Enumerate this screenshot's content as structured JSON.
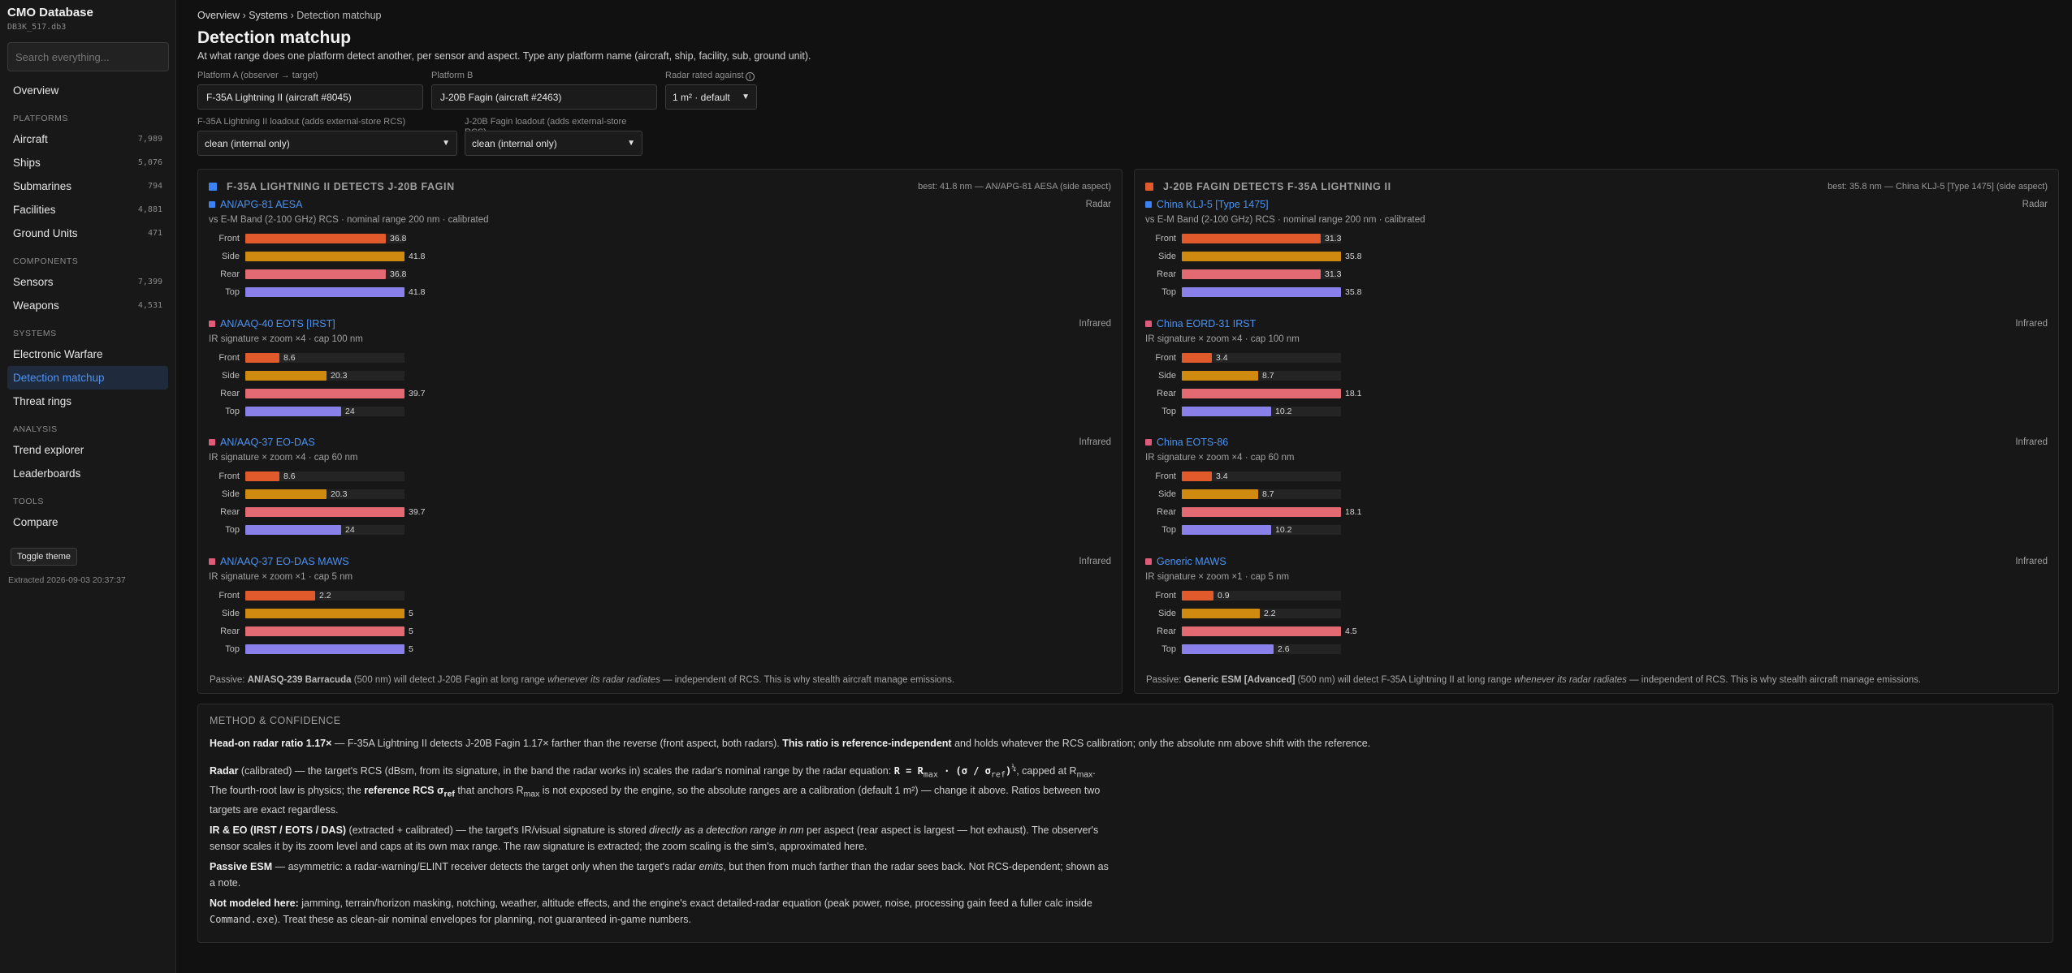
{
  "sidebar": {
    "title": "CMO Database",
    "db_file": "DB3K_517.db3",
    "search_placeholder": "Search everything...",
    "overview": "Overview",
    "sections": [
      {
        "label": "PLATFORMS",
        "items": [
          {
            "label": "Aircraft",
            "count": "7,989"
          },
          {
            "label": "Ships",
            "count": "5,076"
          },
          {
            "label": "Submarines",
            "count": "794"
          },
          {
            "label": "Facilities",
            "count": "4,881"
          },
          {
            "label": "Ground Units",
            "count": "471"
          }
        ]
      },
      {
        "label": "COMPONENTS",
        "items": [
          {
            "label": "Sensors",
            "count": "7,399"
          },
          {
            "label": "Weapons",
            "count": "4,531"
          }
        ]
      },
      {
        "label": "SYSTEMS",
        "items": [
          {
            "label": "Electronic Warfare",
            "count": ""
          },
          {
            "label": "Detection matchup",
            "count": "",
            "active": true
          },
          {
            "label": "Threat rings",
            "count": ""
          }
        ]
      },
      {
        "label": "ANALYSIS",
        "items": [
          {
            "label": "Trend explorer",
            "count": ""
          },
          {
            "label": "Leaderboards",
            "count": ""
          }
        ]
      },
      {
        "label": "TOOLS",
        "items": [
          {
            "label": "Compare",
            "count": ""
          }
        ]
      }
    ],
    "toggle_theme": "Toggle theme",
    "extracted": "Extracted 2026-09-03 20:37:37"
  },
  "page": {
    "breadcrumb": [
      "Overview",
      "Systems",
      "Detection matchup"
    ],
    "title": "Detection matchup",
    "subtitle": "At what range does one platform detect another, per sensor and aspect. Type any platform name (aircraft, ship, facility, sub, ground unit).",
    "platform_a_label": "Platform A (observer → target)",
    "platform_a_value": "F-35A Lightning II (aircraft #8045)",
    "platform_b_label": "Platform B",
    "platform_b_value": "J-20B Fagin (aircraft #2463)",
    "radar_label": "Radar rated against",
    "radar_value": "1 m² · default",
    "loadout_a_label": "F-35A Lightning II loadout (adds external-store RCS)",
    "loadout_a_value": "clean (internal only)",
    "loadout_b_label": "J-20B Fagin loadout (adds external-store RCS)",
    "loadout_b_value": "clean (internal only)"
  },
  "colors": {
    "front": "#e05a2b",
    "side": "#d08a10",
    "rear": "#e36a72",
    "top": "#8a80ea",
    "radar_marker": "#3b82f6",
    "ir_marker": "#e05a7a",
    "panel_a": "#3b82f6",
    "panel_b": "#e05a2b"
  },
  "panels": [
    {
      "title": "F-35A LIGHTNING II DETECTS J-20B FAGIN",
      "best": "best: 41.8 nm — AN/APG-81 AESA (side aspect)",
      "sensors": [
        {
          "name": "AN/APG-81 AESA",
          "type": "Radar",
          "desc": "vs E-M Band (2-100 GHz) RCS · nominal range 200 nm · calibrated",
          "scale_max": 41.8,
          "bars": [
            {
              "label": "Front",
              "value": 36.8
            },
            {
              "label": "Side",
              "value": 41.8
            },
            {
              "label": "Rear",
              "value": 36.8
            },
            {
              "label": "Top",
              "value": 41.8
            }
          ]
        },
        {
          "name": "AN/AAQ-40 EOTS [IRST]",
          "type": "Infrared",
          "desc": "IR signature × zoom ×4 · cap 100 nm",
          "scale_max": 39.7,
          "bars": [
            {
              "label": "Front",
              "value": 8.6
            },
            {
              "label": "Side",
              "value": 20.3
            },
            {
              "label": "Rear",
              "value": 39.7
            },
            {
              "label": "Top",
              "value": 24
            }
          ]
        },
        {
          "name": "AN/AAQ-37 EO-DAS",
          "type": "Infrared",
          "desc": "IR signature × zoom ×4 · cap 60 nm",
          "scale_max": 39.7,
          "bars": [
            {
              "label": "Front",
              "value": 8.6
            },
            {
              "label": "Side",
              "value": 20.3
            },
            {
              "label": "Rear",
              "value": 39.7
            },
            {
              "label": "Top",
              "value": 24
            }
          ]
        },
        {
          "name": "AN/AAQ-37 EO-DAS MAWS",
          "type": "Infrared",
          "desc": "IR signature × zoom ×1 · cap 5 nm",
          "scale_max": 5,
          "bars": [
            {
              "label": "Front",
              "value": 2.2
            },
            {
              "label": "Side",
              "value": 5
            },
            {
              "label": "Rear",
              "value": 5
            },
            {
              "label": "Top",
              "value": 5
            }
          ]
        }
      ],
      "passive_pre": "Passive: ",
      "passive_sensor": "AN/ASQ-239 Barracuda",
      "passive_mid": " (500 nm) will detect J-20B Fagin at long range ",
      "passive_em": "whenever its radar radiates",
      "passive_post": " — independent of RCS. This is why stealth aircraft manage emissions."
    },
    {
      "title": "J-20B FAGIN DETECTS F-35A LIGHTNING II",
      "best": "best: 35.8 nm — China KLJ-5 [Type 1475] (side aspect)",
      "sensors": [
        {
          "name": "China KLJ-5 [Type 1475]",
          "type": "Radar",
          "desc": "vs E-M Band (2-100 GHz) RCS · nominal range 200 nm · calibrated",
          "scale_max": 35.8,
          "bars": [
            {
              "label": "Front",
              "value": 31.3
            },
            {
              "label": "Side",
              "value": 35.8
            },
            {
              "label": "Rear",
              "value": 31.3
            },
            {
              "label": "Top",
              "value": 35.8
            }
          ]
        },
        {
          "name": "China EORD-31 IRST",
          "type": "Infrared",
          "desc": "IR signature × zoom ×4 · cap 100 nm",
          "scale_max": 18.1,
          "bars": [
            {
              "label": "Front",
              "value": 3.4
            },
            {
              "label": "Side",
              "value": 8.7
            },
            {
              "label": "Rear",
              "value": 18.1
            },
            {
              "label": "Top",
              "value": 10.2
            }
          ]
        },
        {
          "name": "China EOTS-86",
          "type": "Infrared",
          "desc": "IR signature × zoom ×4 · cap 60 nm",
          "scale_max": 18.1,
          "bars": [
            {
              "label": "Front",
              "value": 3.4
            },
            {
              "label": "Side",
              "value": 8.7
            },
            {
              "label": "Rear",
              "value": 18.1
            },
            {
              "label": "Top",
              "value": 10.2
            }
          ]
        },
        {
          "name": "Generic MAWS",
          "type": "Infrared",
          "desc": "IR signature × zoom ×1 · cap 5 nm",
          "scale_max": 4.5,
          "bars": [
            {
              "label": "Front",
              "value": 0.9
            },
            {
              "label": "Side",
              "value": 2.2
            },
            {
              "label": "Rear",
              "value": 4.5
            },
            {
              "label": "Top",
              "value": 2.6
            }
          ]
        }
      ],
      "passive_pre": "Passive: ",
      "passive_sensor": "Generic ESM [Advanced]",
      "passive_mid": " (500 nm) will detect F-35A Lightning II at long range ",
      "passive_em": "whenever its radar radiates",
      "passive_post": " — independent of RCS. This is why stealth aircraft manage emissions."
    }
  ],
  "method": {
    "title": "METHOD & CONFIDENCE",
    "p1_bold": "Head-on radar ratio 1.17×",
    "p1_mid": " — F-35A Lightning II detects J-20B Fagin 1.17× farther than the reverse (front aspect, both radars). ",
    "p1_bold2": "This ratio is reference-independent",
    "p1_post": " and holds whatever the RCS calibration; only the absolute nm above shift with the reference.",
    "p2_bold": "Radar",
    "p2_a": " (calibrated) — the target's RCS (dBsm, from its signature, in the band the radar works in) scales the radar's nominal range by the radar equation: ",
    "p2_formula": "R = R",
    "p2_formula_sub": "max",
    "p2_formula2": " · (σ / σ",
    "p2_formula2_sub": "ref",
    "p2_formula3": ")",
    "p2_formula3_sup": "¼",
    "p2_b": ", capped at R",
    "p2_b_sub": "max",
    "p2_c": ". The fourth-root law is physics; the ",
    "p2_bold2": "reference RCS σ",
    "p2_bold2_sub": "ref",
    "p2_d": " that anchors R",
    "p2_d_sub": "max",
    "p2_e": " is not exposed by the engine, so the absolute ranges are a calibration (default 1 m²) — change it above. Ratios between two targets are exact regardless.",
    "p3_bold": "IR & EO (IRST / EOTS / DAS)",
    "p3_a": " (extracted + calibrated) — the target's IR/visual signature is stored ",
    "p3_em": "directly as a detection range in nm",
    "p3_b": " per aspect (rear aspect is largest — hot exhaust). The observer's sensor scales it by its zoom level and caps at its own max range. The raw signature is extracted; the zoom scaling is the sim's, approximated here.",
    "p4_bold": "Passive ESM",
    "p4_a": " — asymmetric: a radar-warning/ELINT receiver detects the target only when the target's radar ",
    "p4_em": "emits",
    "p4_b": ", but then from much farther than the radar sees back. Not RCS-dependent; shown as a note.",
    "p5_bold": "Not modeled here:",
    "p5_a": " jamming, terrain/horizon masking, notching, weather, altitude effects, and the engine's exact detailed-radar equation (peak power, noise, processing gain feed a fuller calc inside ",
    "p5_code": "Command.exe",
    "p5_b": "). Treat these as clean-air nominal envelopes for planning, not guaranteed in-game numbers."
  }
}
